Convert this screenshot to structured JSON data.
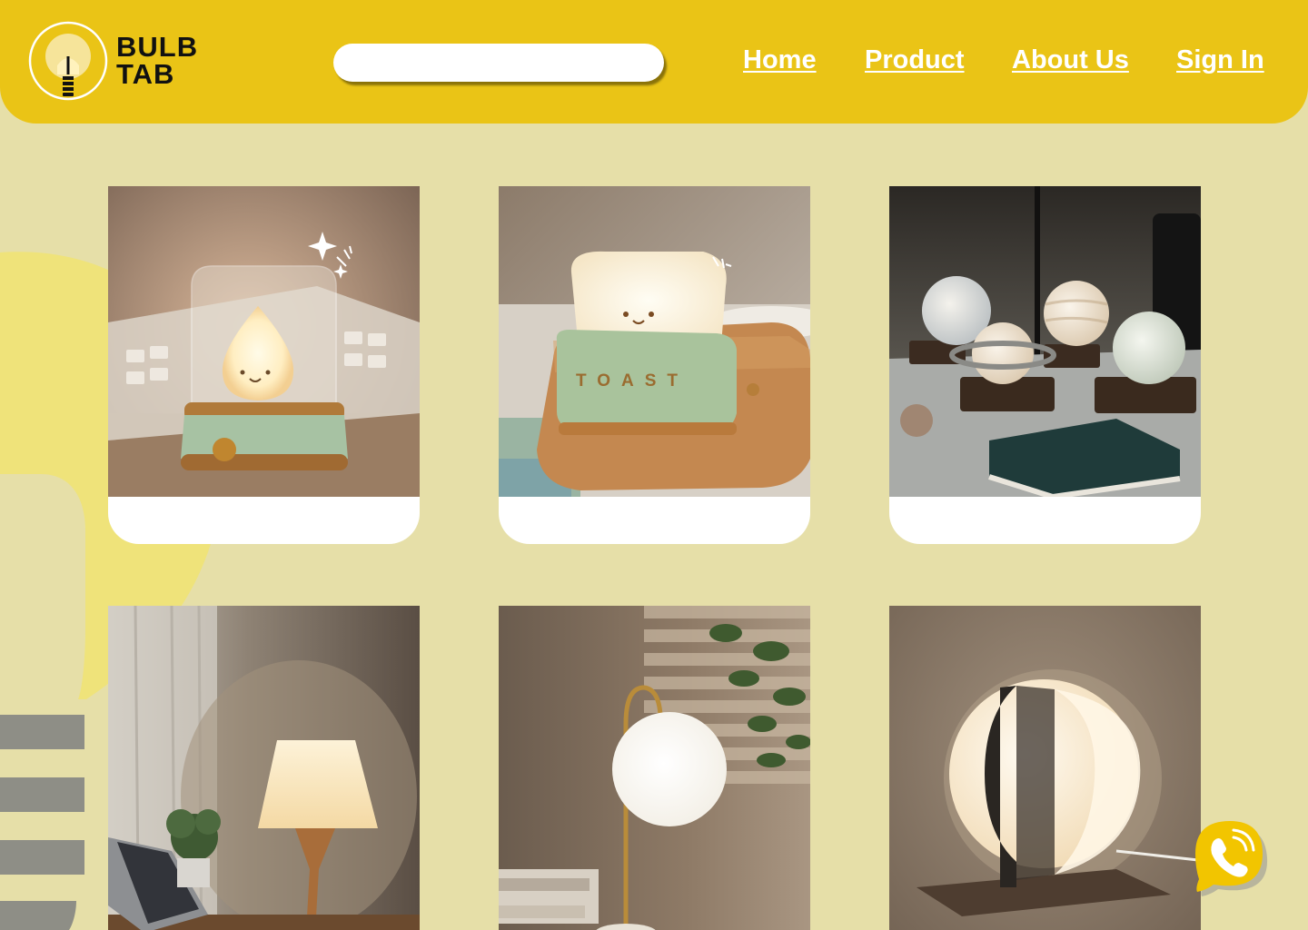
{
  "brand": {
    "line1": "BULB",
    "line2": "TAB",
    "color": "#eac416"
  },
  "search": {
    "placeholder": ""
  },
  "nav": {
    "home": "Home",
    "product": "Product",
    "about": "About Us",
    "signin": "Sign In"
  },
  "products": [
    {
      "name": "jar-night-light",
      "icon": "drop-lamp-photo"
    },
    {
      "name": "toast-lamp",
      "icon": "toast-lamp-photo",
      "stamp": "TOAST"
    },
    {
      "name": "planet-lamps",
      "icon": "planet-lamp-photo"
    },
    {
      "name": "table-lamp",
      "icon": "table-lamp-photo"
    },
    {
      "name": "globe-desk-lamp",
      "icon": "globe-lamp-photo"
    },
    {
      "name": "half-moon-lamp",
      "icon": "moon-lamp-photo"
    }
  ],
  "contact": {
    "icon": "phone-icon",
    "color": "#f2c500"
  },
  "colors": {
    "background": "#e6dfa8",
    "header": "#eac416",
    "nav_text": "#ffffff"
  }
}
